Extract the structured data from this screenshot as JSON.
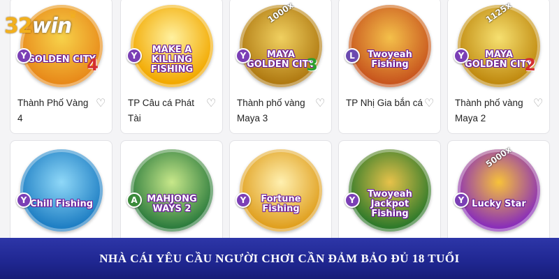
{
  "brand": {
    "logo_number": "32",
    "logo_word": "win"
  },
  "games": [
    {
      "art_title": "GOLDEN CITY",
      "art_number": "4",
      "badge": "Y",
      "multiplier": "",
      "name": "Thành Phố Vàng 4",
      "bg": "#e88a1a",
      "bg2": "#f7d24a"
    },
    {
      "art_title": "MAKE A KILLING FISHING",
      "art_number": "",
      "badge": "Y",
      "multiplier": "",
      "name": "TP Câu cá Phát Tài",
      "bg": "#f2a900",
      "bg2": "#fff1a0"
    },
    {
      "art_title": "MAYA GOLDEN CITY",
      "art_number": "3",
      "badge": "Y",
      "multiplier": "1000x",
      "name": "Thành phố vàng Maya 3",
      "bg": "#b07a12",
      "bg2": "#f0d060"
    },
    {
      "art_title": "Twoyeah Fishing",
      "art_number": "",
      "badge": "L",
      "multiplier": "",
      "name": "TP Nhị Gia bắn cá",
      "bg": "#c8561e",
      "bg2": "#f4c04a"
    },
    {
      "art_title": "MAYA GOLDEN CITY",
      "art_number": "2",
      "badge": "Y",
      "multiplier": "1125x",
      "name": "Thành phố vàng Maya 2",
      "bg": "#c08a10",
      "bg2": "#f6e070"
    },
    {
      "art_title": "Chill Fishing",
      "art_number": "",
      "badge": "Y",
      "multiplier": "",
      "name": "",
      "bg": "#1f7fc4",
      "bg2": "#8fd8f8"
    },
    {
      "art_title": "MAHJONG WAYS 2",
      "art_number": "",
      "badge": "A",
      "multiplier": "",
      "name": "",
      "bg": "#2e7d3e",
      "bg2": "#c8e88a"
    },
    {
      "art_title": "Fortune Fishing",
      "art_number": "",
      "badge": "Y",
      "multiplier": "",
      "name": "",
      "bg": "#e0a020",
      "bg2": "#fff0b0"
    },
    {
      "art_title": "Twoyeah Jackpot Fishing",
      "art_number": "",
      "badge": "Y",
      "multiplier": "",
      "name": "",
      "bg": "#2f7a2a",
      "bg2": "#e7c24a"
    },
    {
      "art_title": "Lucky Star",
      "art_number": "",
      "badge": "Y",
      "multiplier": "5000x",
      "name": "",
      "bg": "#8a2fb8",
      "bg2": "#f7c23a"
    }
  ],
  "banner": {
    "text": "NHÀ CÁI YÊU CẦU NGƯỜI CHƠI CẦN ĐẢM BẢO ĐỦ 18 TUỔI"
  },
  "icons": {
    "favorite": "heart-outline-icon"
  }
}
